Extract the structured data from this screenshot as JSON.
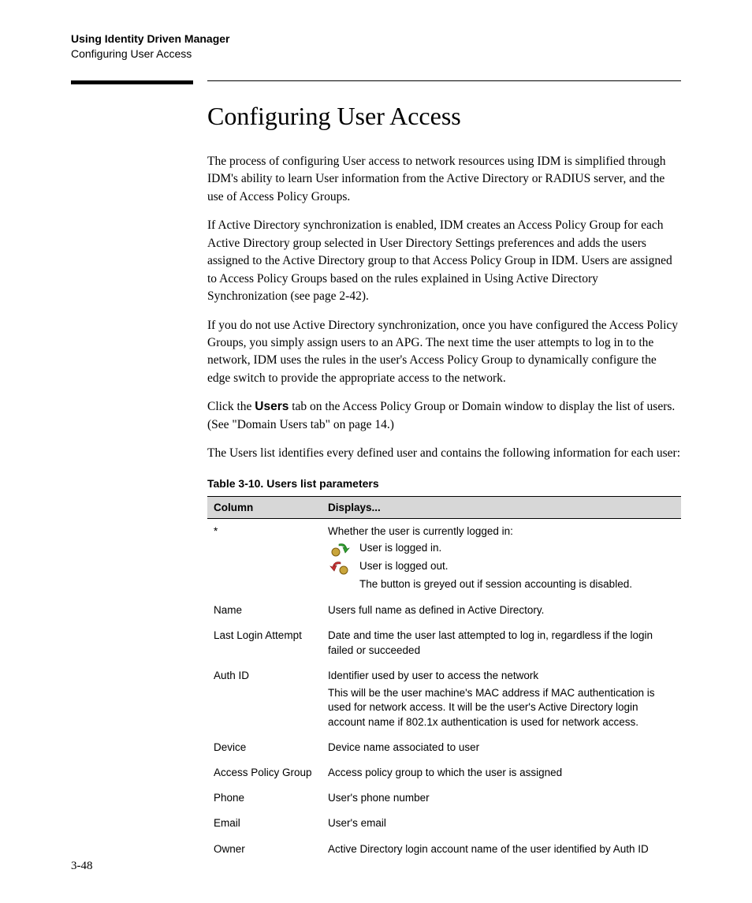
{
  "header": {
    "line1": "Using Identity Driven Manager",
    "line2": "Configuring User Access"
  },
  "title": "Configuring User Access",
  "paragraphs": {
    "p1": "The process of configuring User access to network resources using IDM is simplified through IDM's ability to learn User information from the Active Directory or RADIUS server, and the use of Access Policy Groups.",
    "p2": "If Active Directory synchronization is enabled, IDM creates an Access Policy Group for each Active Directory group selected in User Directory Settings preferences and adds the users assigned to the Active Directory group to that Access Policy Group in IDM. Users are assigned to Access Policy Groups based on the rules explained in Using Active Directory Synchronization (see page 2-42).",
    "p3": "If you do not use Active Directory synchronization, once you have configured the Access Policy Groups, you simply assign users to an APG. The next time the user attempts to log in to the network, IDM uses the rules in the user's Access Policy Group to dynamically configure the edge switch to provide the appropriate access to the network.",
    "p4a": "Click the ",
    "p4b": "Users",
    "p4c": " tab on the Access Policy Group or Domain window to display the list of users. (See \"Domain Users tab\" on page 14.)",
    "p5": "The Users list identifies every defined user and contains the following information for each user:"
  },
  "table": {
    "caption": "Table 3-10.   Users list parameters",
    "head": {
      "c1": "Column",
      "c2": "Displays..."
    },
    "rows": [
      {
        "c1": "*",
        "c2_intro": "Whether the user is currently logged in:",
        "c2_in": "User is logged in.",
        "c2_out": "User is logged out.",
        "c2_note": "The button is greyed out if session accounting is disabled."
      },
      {
        "c1": "Name",
        "c2": "Users full name as defined in Active Directory."
      },
      {
        "c1": "Last Login Attempt",
        "c2": "Date and time the user last attempted to log in, regardless if the login failed or succeeded"
      },
      {
        "c1": "Auth ID",
        "c2a": "Identifier used by user to access the network",
        "c2b": "This will be the user machine's MAC address if MAC authentication is used for network access. It will be the user's Active Directory login account name if 802.1x authentication is used for network access."
      },
      {
        "c1": "Device",
        "c2": "Device name associated to user"
      },
      {
        "c1": "Access Policy Group",
        "c2": "Access policy group to which the user is assigned"
      },
      {
        "c1": "Phone",
        "c2": "User's phone number"
      },
      {
        "c1": "Email",
        "c2": "User's email"
      },
      {
        "c1": "Owner",
        "c2": "Active Directory login account name of the user identified by Auth ID"
      }
    ]
  },
  "page_number": "3-48"
}
